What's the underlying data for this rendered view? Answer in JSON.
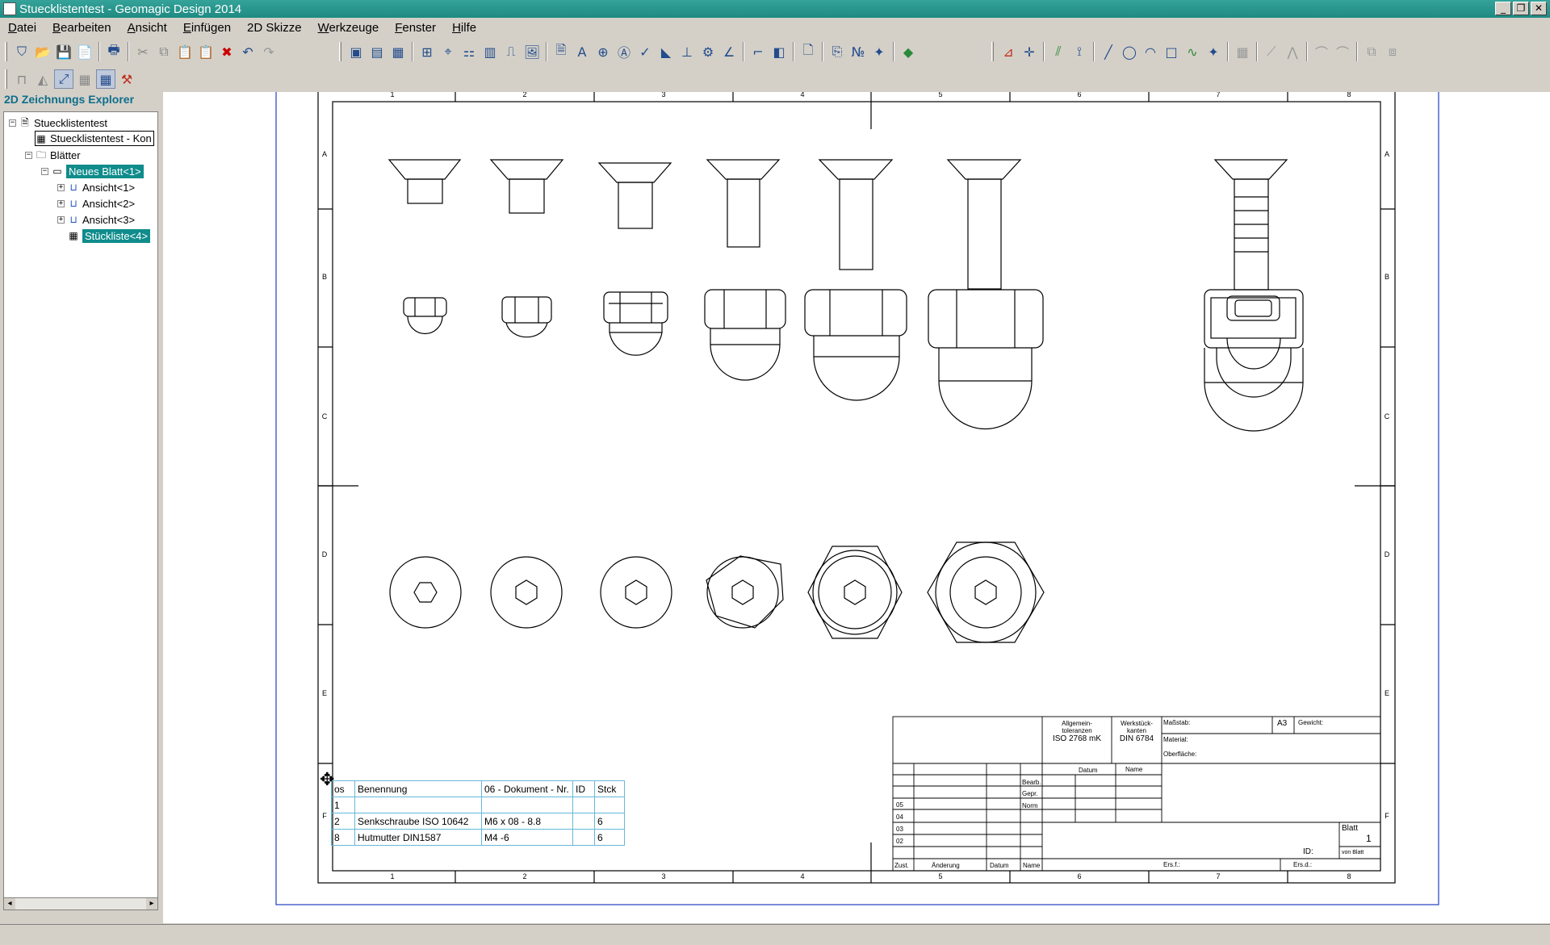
{
  "window": {
    "title": "Stuecklistentest - Geomagic Design 2014"
  },
  "window_buttons": [
    "_",
    "❐",
    "✕"
  ],
  "menu": [
    {
      "mnemonic": "D",
      "rest": "atei"
    },
    {
      "mnemonic": "B",
      "rest": "earbeiten"
    },
    {
      "mnemonic": "A",
      "rest": "nsicht"
    },
    {
      "mnemonic": "E",
      "rest": "infügen"
    },
    {
      "mnemonic": "2",
      "rest": "D Skizze"
    },
    {
      "mnemonic": "W",
      "rest": "erkzeuge"
    },
    {
      "mnemonic": "F",
      "rest": "enster"
    },
    {
      "mnemonic": "H",
      "rest": "ilfe"
    }
  ],
  "explorer": {
    "title": "2D Zeichnungs Explorer",
    "tree": [
      {
        "label": "Stuecklistentest",
        "expander": "−"
      },
      {
        "label": "Stuecklistentest - Kon",
        "expander": ""
      },
      {
        "label": "Blätter",
        "expander": "−"
      },
      {
        "label": "Neues Blatt<1>",
        "expander": "−"
      },
      {
        "label": "Ansicht<1>",
        "expander": "+"
      },
      {
        "label": "Ansicht<2>",
        "expander": "+"
      },
      {
        "label": "Ansicht<3>",
        "expander": "+"
      },
      {
        "label": "Stückliste<4>",
        "expander": ""
      }
    ]
  },
  "drawing": {
    "zone_columns": [
      "1",
      "2",
      "3",
      "4",
      "5",
      "6",
      "7",
      "8"
    ],
    "zone_rows": [
      "A",
      "B",
      "C",
      "D",
      "E",
      "F"
    ],
    "bom": {
      "headers": [
        "os",
        "Benennung",
        "06 - Dokument - Nr.",
        "ID",
        "Stck"
      ],
      "rows": [
        [
          "1",
          "",
          "",
          "",
          ""
        ],
        [
          "2",
          "Senkschraube ISO 10642",
          "M6 x 08 - 8.8",
          "",
          "6"
        ],
        [
          "8",
          "Hutmutter DIN1587",
          "M4 -6",
          "",
          "6"
        ]
      ]
    },
    "title_block": {
      "tol1_line1": "Allgemein-",
      "tol1_line2": "toleranzen",
      "tol1_line3": "ISO 2768 mK",
      "tol2_line1": "Werkstück-",
      "tol2_line2": "kanten",
      "tol2_line3": "DIN 6784",
      "massstab": "Maßstab:",
      "format": "A3",
      "gewicht": "Gewicht:",
      "material": "Material:",
      "oberflaeche": "Oberfläche:",
      "datum": "Datum",
      "name": "Name",
      "bearb": "Bearb.",
      "gepr": "Gepr.",
      "norm": "Norm",
      "rev": [
        "05",
        "04",
        "03",
        "02"
      ],
      "zust": "Zust.",
      "aenderung": "Änderung",
      "datum2": "Datum",
      "name2": "Name",
      "blatt": "Blatt",
      "blatt_nr": "1",
      "von_blatt": "von Blatt",
      "id": "ID:",
      "ers_f": "Ers.f.:",
      "ers_d": "Ers.d.:"
    }
  }
}
